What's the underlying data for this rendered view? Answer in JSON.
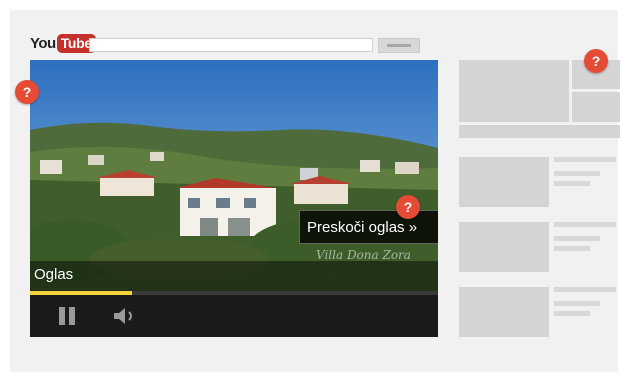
{
  "header": {
    "logo_you": "You",
    "logo_tube": "Tube"
  },
  "player": {
    "ad_label": "Oglas",
    "skip_label": "Preskoči oglas »",
    "watermark": "Villa Dona Zora",
    "progress": 0.25,
    "progress_color": "#f4d43b"
  },
  "help_markers": {
    "symbol": "?",
    "color": "#e64b35"
  },
  "icons": [
    "pause-icon",
    "volume-icon",
    "help-icon"
  ]
}
